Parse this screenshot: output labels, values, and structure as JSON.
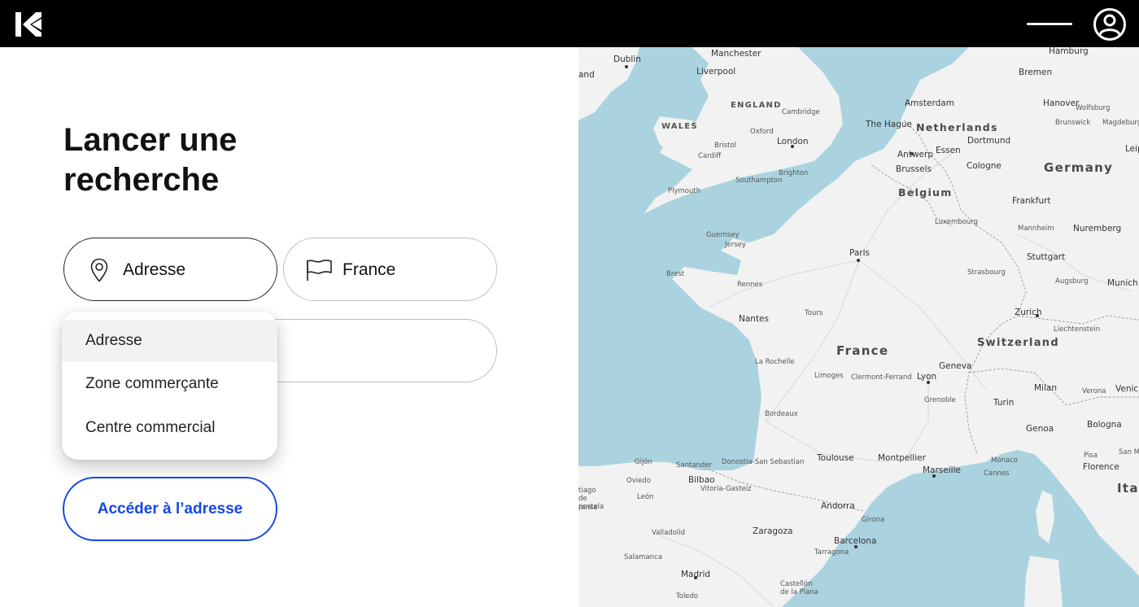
{
  "header": {
    "logo_icon": "k-logo-icon",
    "menu_icon": "hamburger-menu-icon",
    "account_icon": "user-account-icon"
  },
  "search": {
    "title_line1": "Lancer une",
    "title_line2": "recherche",
    "type_selected": "Adresse",
    "type_icon": "map-pin-icon",
    "country_selected": "France",
    "country_icon": "flag-icon",
    "address_input_value": "",
    "dropdown_options": [
      "Adresse",
      "Zone commerçante",
      "Centre commercial"
    ],
    "dropdown_active_index": 0,
    "submit_label": "Accéder à l’adresse"
  },
  "colors": {
    "accent": "#1447e6",
    "header_bg": "#000000",
    "sea": "#aad3df",
    "land": "#f2f2f2"
  },
  "map": {
    "labels": {
      "countries": [
        "France",
        "Germany",
        "Switzerland",
        "Belgium",
        "Netherlands",
        "Ital"
      ],
      "regions": [
        "ENGLAND",
        "WALES"
      ],
      "cities": [
        "Dublin",
        "Manchester",
        "Liverpool",
        "Hamburg",
        "Bremen",
        "Amsterdam",
        "Hanover",
        "Wolfsburg",
        "Brunswick",
        "Magdeburg",
        "Cambridge",
        "Oxford",
        "London",
        "Bristol",
        "Cardiff",
        "Southampton",
        "Brighton",
        "Plymouth",
        "The Hague",
        "Antwerp",
        "Essen",
        "Dortmund",
        "Brussels",
        "Cologne",
        "Leipzi",
        "Frankfurt",
        "Luxembourg",
        "Mannheim",
        "Nuremberg",
        "Guernsey",
        "Jersey",
        "Paris",
        "Stuttgart",
        "Strasbourg",
        "Augsburg",
        "Munich",
        "Brest",
        "Rennes",
        "Zurich",
        "Liechtenstein",
        "Nantes",
        "Tours",
        "La Rochelle",
        "Geneva",
        "Limoges",
        "Clermont-Ferrand",
        "Lyon",
        "Milan",
        "Verona",
        "Venic",
        "Grenoble",
        "Turin",
        "Bordeaux",
        "Genoa",
        "Bologna",
        "Toulouse",
        "Montpellier",
        "Marseille",
        "Monaco",
        "Cannes",
        "Pisa",
        "Florence",
        "San M",
        "Gijón",
        "Oviedo",
        "Santander",
        "Donostia-San Sebastian",
        "Bilbao",
        "Vitoria-Gasteiz",
        "tiago de postela",
        "León",
        "rense",
        "Andorra",
        "Girona",
        "Valladolid",
        "Zaragoza",
        "Barcelona",
        "Tarragona",
        "Salamanca",
        "Madrid",
        "Toledo",
        "Castellón de la Plana",
        "and"
      ]
    }
  }
}
